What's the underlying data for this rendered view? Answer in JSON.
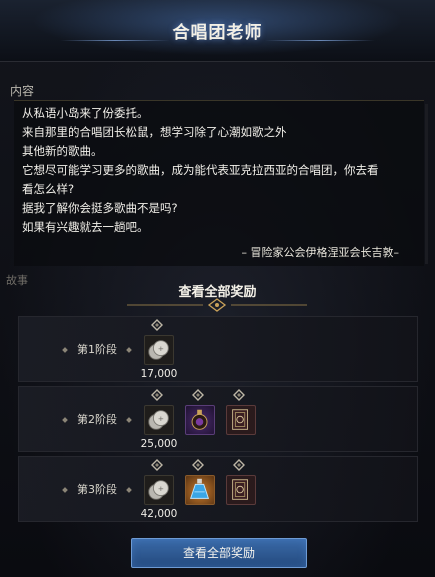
{
  "window": {
    "title": "合唱团老师"
  },
  "content_section": {
    "label": "内容",
    "lines": [
      "从私语小岛来了份委托。",
      "来自那里的合唱团长松鼠，想学习除了心潮如歌之外",
      "其他新的歌曲。",
      "它想尽可能学习更多的歌曲，成为能代表亚克拉西亚的合唱团，你去看",
      "看怎么样?",
      "据我了解你会挺多歌曲不是吗?",
      "如果有兴趣就去一趟吧。"
    ],
    "signature": "– 冒险家公会伊格涅亚会长吉敦–"
  },
  "side_tab": {
    "label": "故事"
  },
  "rewards": {
    "header": "查看全部奖励",
    "stages": [
      {
        "label": "第1阶段",
        "items": [
          {
            "icon": "silver-coin-icon",
            "quantity": "17,000"
          }
        ]
      },
      {
        "label": "第2阶段",
        "items": [
          {
            "icon": "silver-coin-icon",
            "quantity": "25,000"
          },
          {
            "icon": "purple-potion-icon"
          },
          {
            "icon": "card-pack-icon"
          }
        ]
      },
      {
        "label": "第3阶段",
        "items": [
          {
            "icon": "silver-coin-icon",
            "quantity": "42,000"
          },
          {
            "icon": "blue-potion-icon"
          },
          {
            "icon": "card-pack-icon"
          }
        ]
      }
    ]
  },
  "footer_button": {
    "label": "查看全部奖励"
  },
  "colors": {
    "accent": "#3a6aa8",
    "gold": "#c9a25a"
  }
}
